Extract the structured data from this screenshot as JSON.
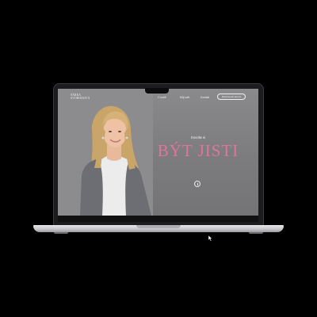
{
  "site": {
    "logo_line1": "Šárka",
    "logo_line2": "Svobodová",
    "nav": [
      {
        "label": "O sobě"
      },
      {
        "label": "Můj svět"
      },
      {
        "label": "Kontakt"
      }
    ],
    "cta_label": "Rezervovat termín"
  },
  "hero": {
    "subtitle": "Dovolte si",
    "headline": "BÝT JISTI"
  },
  "colors": {
    "headline": "#e0759a",
    "screen_bg": "#808082",
    "device_frame": "#1c1c1e"
  },
  "icons": {
    "scroll": "scroll-down-icon",
    "cursor": "mouse-cursor-icon"
  }
}
